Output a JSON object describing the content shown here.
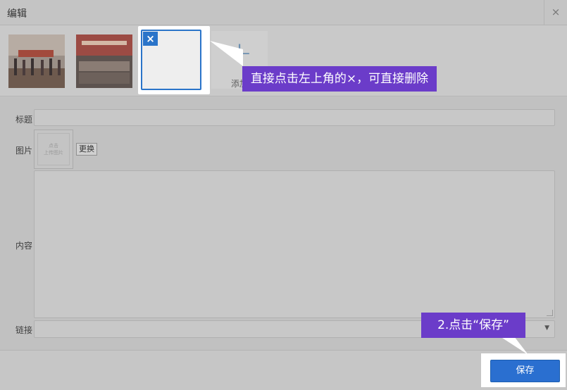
{
  "dialog": {
    "title": "编辑",
    "close_symbol": "×"
  },
  "images": {
    "delete_symbol": "×",
    "add_symbol": "+",
    "add_label": "添加"
  },
  "callouts": {
    "delete_tip": "直接点击左上角的×，可直接删除",
    "save_tip": "2.点击“保存”"
  },
  "form": {
    "title_label": "标题",
    "title_value": "",
    "image_label": "图片",
    "image_placeholder_line1": "点击",
    "image_placeholder_line2": "上传图片",
    "change_button": "更换",
    "content_label": "内容",
    "content_value": "",
    "link_label": "链接",
    "link_value": "",
    "link_arrow": "▼"
  },
  "footer": {
    "save_button": "保存"
  },
  "colors": {
    "accent": "#2a74c9",
    "callout": "#6b3cc9",
    "overlay": "#c4c4c4"
  }
}
